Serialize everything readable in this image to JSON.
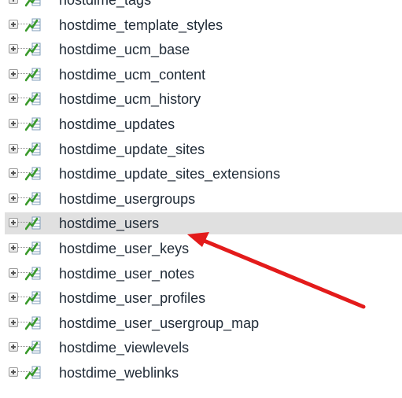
{
  "tables": [
    {
      "name": "hostdime_tags"
    },
    {
      "name": "hostdime_template_styles"
    },
    {
      "name": "hostdime_ucm_base"
    },
    {
      "name": "hostdime_ucm_content"
    },
    {
      "name": "hostdime_ucm_history"
    },
    {
      "name": "hostdime_updates"
    },
    {
      "name": "hostdime_update_sites"
    },
    {
      "name": "hostdime_update_sites_extensions"
    },
    {
      "name": "hostdime_usergroups"
    },
    {
      "name": "hostdime_users",
      "highlighted": true
    },
    {
      "name": "hostdime_user_keys"
    },
    {
      "name": "hostdime_user_notes"
    },
    {
      "name": "hostdime_user_profiles"
    },
    {
      "name": "hostdime_user_usergroup_map"
    },
    {
      "name": "hostdime_viewlevels"
    },
    {
      "name": "hostdime_weblinks"
    }
  ],
  "icons": {
    "expander": "plus-box-icon",
    "table": "table-structure-icon"
  },
  "colors": {
    "highlight": "#e0e0e0",
    "arrow": "#e31b1b",
    "text": "#1f2a36"
  }
}
